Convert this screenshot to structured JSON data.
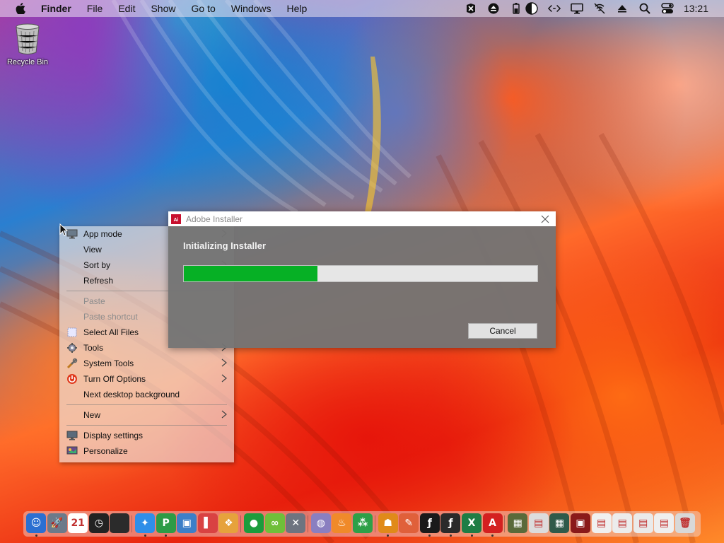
{
  "menubar": {
    "apple_icon": "apple-icon",
    "items": [
      "Finder",
      "File",
      "Edit",
      "Show",
      "Go to",
      "Windows",
      "Help"
    ],
    "status_icons": [
      "vscodium-icon",
      "eject-circle-icon",
      "battery-icon",
      "half-moon-icon",
      "code-arrows-icon",
      "display-icon",
      "bell-off-icon",
      "eject-icon",
      "search-icon",
      "control-center-icon"
    ],
    "clock": "13:21"
  },
  "desktop": {
    "recycle_bin_label": "Recycle Bin"
  },
  "context_menu": {
    "items": [
      {
        "label": "App mode",
        "icon": "monitor-icon",
        "submenu": true,
        "disabled": false
      },
      {
        "label": "View",
        "icon": "",
        "submenu": true,
        "disabled": false
      },
      {
        "label": "Sort by",
        "icon": "",
        "submenu": true,
        "disabled": false
      },
      {
        "label": "Refresh",
        "icon": "",
        "submenu": false,
        "disabled": false
      },
      {
        "label": "Paste",
        "icon": "",
        "submenu": false,
        "disabled": true
      },
      {
        "label": "Paste shortcut",
        "icon": "",
        "submenu": false,
        "disabled": true
      },
      {
        "label": "Select All Files",
        "icon": "select-icon",
        "submenu": false,
        "disabled": false
      },
      {
        "label": "Tools",
        "icon": "tools-gear-icon",
        "submenu": true,
        "disabled": false
      },
      {
        "label": "System Tools",
        "icon": "wrench-icon",
        "submenu": true,
        "disabled": false
      },
      {
        "label": "Turn Off Options",
        "icon": "power-icon",
        "submenu": true,
        "disabled": false
      },
      {
        "label": "Next desktop background",
        "icon": "",
        "submenu": false,
        "disabled": false
      },
      {
        "label": "New",
        "icon": "",
        "submenu": true,
        "disabled": false
      },
      {
        "label": "Display settings",
        "icon": "display-settings-icon",
        "submenu": false,
        "disabled": false
      },
      {
        "label": "Personalize",
        "icon": "personalize-icon",
        "submenu": false,
        "disabled": false
      }
    ]
  },
  "dialog": {
    "title": "Adobe Installer",
    "heading": "Initializing Installer",
    "progress": 0.377,
    "cancel_label": "Cancel"
  },
  "dock": {
    "apps": [
      {
        "name": "finder-icon",
        "glyph": "☺",
        "color": "#2b6fd1",
        "running": true
      },
      {
        "name": "launchpad-icon",
        "glyph": "🚀",
        "color": "#6c7a8a",
        "running": false
      },
      {
        "name": "calendar-icon",
        "glyph": "21",
        "color": "#ffffff",
        "running": false
      },
      {
        "name": "clock-icon",
        "glyph": "◷",
        "color": "#222222",
        "running": false
      },
      {
        "name": "apple-store-icon",
        "glyph": "",
        "color": "#2b2b2b",
        "running": false
      },
      {
        "name": "safari-icon",
        "glyph": "✦",
        "color": "#2f8ee8",
        "running": true
      },
      {
        "name": "project-icon",
        "glyph": "P",
        "color": "#2d9b46",
        "running": true
      },
      {
        "name": "remote-desktop-icon",
        "glyph": "▣",
        "color": "#3d7fc8",
        "running": false
      },
      {
        "name": "book-icon",
        "glyph": "▌",
        "color": "#d94242",
        "running": false
      },
      {
        "name": "photos-icon",
        "glyph": "❖",
        "color": "#e6a23c",
        "running": false
      },
      {
        "name": "chat-icon",
        "glyph": "●",
        "color": "#1c9c3c",
        "running": false
      },
      {
        "name": "link-icon",
        "glyph": "∞",
        "color": "#6fbf3a",
        "running": false
      },
      {
        "name": "system-tools-icon",
        "glyph": "✕",
        "color": "#6e7480",
        "running": false
      },
      {
        "name": "globe-icon",
        "glyph": "◍",
        "color": "#8a7fc0",
        "running": false
      },
      {
        "name": "fire-icon",
        "glyph": "♨",
        "color": "#f08a2a",
        "running": false
      },
      {
        "name": "dots-icon",
        "glyph": "⁂",
        "color": "#2ea048",
        "running": false
      },
      {
        "name": "contacts-icon",
        "glyph": "☗",
        "color": "#e08a1a",
        "running": true
      },
      {
        "name": "paint-icon",
        "glyph": "✎",
        "color": "#e0603a",
        "running": false
      },
      {
        "name": "flash-icon",
        "glyph": "ƒ",
        "color": "#1a1a1a",
        "running": true
      },
      {
        "name": "flash-player-icon",
        "glyph": "ƒ",
        "color": "#2a2a2a",
        "running": true
      },
      {
        "name": "excel-icon",
        "glyph": "X",
        "color": "#1e7d45",
        "running": true
      },
      {
        "name": "acrobat-icon",
        "glyph": "A",
        "color": "#d42020",
        "running": true
      },
      {
        "name": "thumbnail-1-icon",
        "glyph": "▦",
        "color": "#5a6a3a",
        "running": false
      },
      {
        "name": "thumbnail-2-icon",
        "glyph": "▤",
        "color": "#dcdcdc",
        "running": false
      },
      {
        "name": "thumbnail-3-icon",
        "glyph": "▦",
        "color": "#2f5a4a",
        "running": false
      },
      {
        "name": "thumbnail-4-icon",
        "glyph": "▣",
        "color": "#8a1a1a",
        "running": false
      },
      {
        "name": "thumbnail-5-icon",
        "glyph": "▤",
        "color": "#f0f0f0",
        "running": false
      },
      {
        "name": "thumbnail-6-icon",
        "glyph": "▤",
        "color": "#ececec",
        "running": false
      },
      {
        "name": "thumbnail-7-icon",
        "glyph": "▤",
        "color": "#eaeaea",
        "running": false
      },
      {
        "name": "thumbnail-8-icon",
        "glyph": "▤",
        "color": "#efefef",
        "running": false
      },
      {
        "name": "trash-icon",
        "glyph": "🗑",
        "color": "#d8d8d8",
        "running": false
      }
    ]
  }
}
